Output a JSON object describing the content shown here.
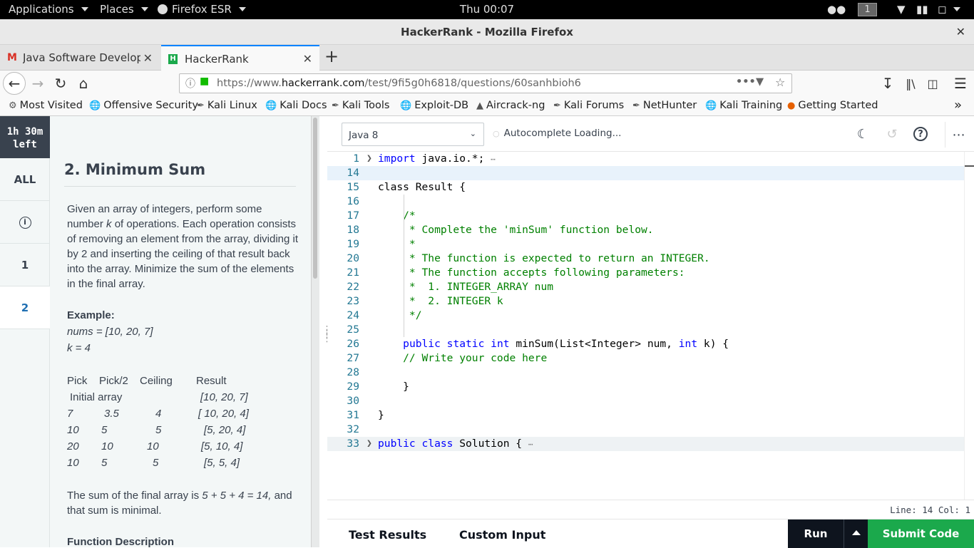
{
  "system_bar": {
    "applications": "Applications",
    "places": "Places",
    "firefox": "Firefox ESR",
    "clock": "Thu 00:07",
    "workspace": "1"
  },
  "window": {
    "title": "HackerRank - Mozilla Firefox"
  },
  "tabs": [
    {
      "label": "Java Software Developer",
      "favicon": "gmail-icon"
    },
    {
      "label": "HackerRank",
      "favicon": "hackerrank-icon"
    }
  ],
  "url": {
    "prefix": "https://www.",
    "domain": "hackerrank.com",
    "path": "/test/9fi5g0h6818/questions/60sanhbioh6"
  },
  "bookmarks": [
    "Most Visited",
    "Offensive Security",
    "Kali Linux",
    "Kali Docs",
    "Kali Tools",
    "Exploit-DB",
    "Aircrack-ng",
    "Kali Forums",
    "NetHunter",
    "Kali Training",
    "Getting Started"
  ],
  "rail": {
    "timer_line1": "1h 30m",
    "timer_line2": "left",
    "all": "ALL",
    "q1": "1",
    "q2": "2"
  },
  "problem": {
    "title": "2. Minimum Sum",
    "desc": [
      "Given an array of integers, perform some",
      "of operations. Each operation consists",
      "of removing an element from the array, dividing it",
      "by 2 and inserting the ceiling of that result back",
      "into the array. Minimize the sum of the elements",
      "in the final array."
    ],
    "desc_line2_prefix": "number ",
    "desc_k": "k",
    "example_heading": "Example:",
    "example_nums": "nums = [10, 20, 7]",
    "example_k": "k = 4",
    "table_headers": [
      "Pick",
      "Pick/2",
      "Ceiling",
      "Result"
    ],
    "initial_label": "Initial array",
    "initial_result": "[10, 20, 7]",
    "rows": [
      [
        "7",
        "3.5",
        "4",
        "[ 10, 20, 4]"
      ],
      [
        "10",
        "5",
        "5",
        "[5, 20, 4]"
      ],
      [
        "20",
        "10",
        "10",
        "[5, 10, 4]"
      ],
      [
        "10",
        "5",
        "5",
        "[5, 5, 4]"
      ]
    ],
    "sum_prefix": "The sum of the final array is ",
    "sum_expr": "5 + 5 + 4 = 14,",
    "sum_suffix": " and",
    "sum_line2": "that sum is minimal.",
    "func_heading": "Function Description"
  },
  "editor": {
    "language": "Java 8",
    "autocomplete": "Autocomplete Loading...",
    "status": "Line: 14  Col: 1",
    "lines": [
      {
        "n": "1"
      },
      {
        "n": "14"
      },
      {
        "n": "15"
      },
      {
        "n": "16"
      },
      {
        "n": "17"
      },
      {
        "n": "18"
      },
      {
        "n": "19"
      },
      {
        "n": "20"
      },
      {
        "n": "21"
      },
      {
        "n": "22"
      },
      {
        "n": "23"
      },
      {
        "n": "24"
      },
      {
        "n": "25"
      },
      {
        "n": "26"
      },
      {
        "n": "27"
      },
      {
        "n": "28"
      },
      {
        "n": "29"
      },
      {
        "n": "30"
      },
      {
        "n": "31"
      },
      {
        "n": "32"
      },
      {
        "n": "33"
      }
    ],
    "code": {
      "l1_kw": "import",
      "l1_rest": " java.io.*;",
      "l15": "class Result {",
      "l17": "    /*",
      "l18": "     * Complete the 'minSum' function below.",
      "l19": "     *",
      "l20": "     * The function is expected to return an INTEGER.",
      "l21": "     * The function accepts following parameters:",
      "l22": "     *  1. INTEGER_ARRAY num",
      "l23": "     *  2. INTEGER k",
      "l24": "     */",
      "l26_indent": "    ",
      "l26_kw1": "public static int",
      "l26_mid": " minSum(List<Integer> num, ",
      "l26_kw2": "int",
      "l26_end": " k) {",
      "l27": "    // Write your code here",
      "l29": "    }",
      "l31": "}",
      "l33_kw": "public class",
      "l33_rest": " Solution {"
    }
  },
  "bottom": {
    "test_results": "Test Results",
    "custom_input": "Custom Input",
    "run": "Run",
    "submit": "Submit Code"
  },
  "colors": {
    "accent": "#1ba94c",
    "dark": "#0e141e",
    "rail_active": "#1f6fb2"
  }
}
